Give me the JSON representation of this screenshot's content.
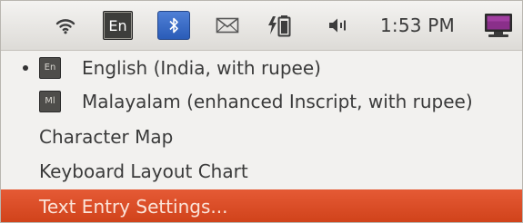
{
  "panel": {
    "input_indicator": "En",
    "clock": "1:53 PM",
    "icons": [
      "wifi-icon",
      "bluetooth-icon",
      "mail-icon",
      "battery-icon",
      "volume-icon",
      "session-icon"
    ]
  },
  "menu": {
    "layouts": [
      {
        "badge": "En",
        "label": "English (India, with rupee)",
        "active": true
      },
      {
        "badge": "Ml",
        "label": "Malayalam (enhanced Inscript, with rupee)",
        "active": false
      }
    ],
    "character_map": "Character Map",
    "keyboard_layout_chart": "Keyboard Layout Chart",
    "text_entry_settings": "Text Entry Settings...",
    "highlight_color": "#dd4814"
  }
}
